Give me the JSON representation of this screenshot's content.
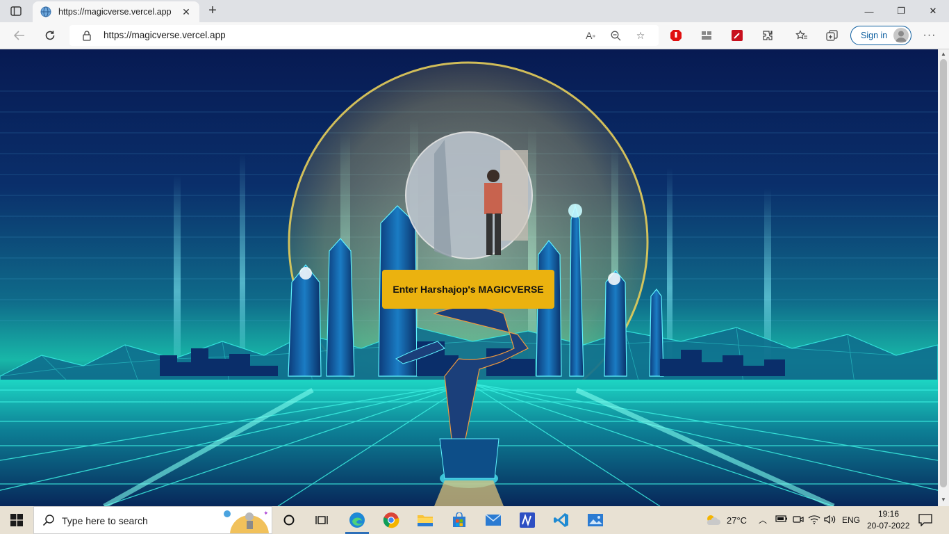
{
  "browser": {
    "tab": {
      "title": "https://magicverse.vercel.app",
      "close": "✕"
    },
    "new_tab": "+",
    "window": {
      "minimize": "—",
      "maximize": "❐",
      "close": "✕"
    },
    "url": "https://magicverse.vercel.app",
    "signin_label": "Sign in",
    "more": "···"
  },
  "page": {
    "enter_button": "Enter Harshajop's MAGICVERSE"
  },
  "taskbar": {
    "search_placeholder": "Type here to search",
    "weather": "27°C",
    "language": "ENG",
    "time": "19:16",
    "date": "20-07-2022"
  },
  "colors": {
    "accent_button": "#ebb20f",
    "signin_border": "#0a5c9e",
    "taskbar_bg": "#e8e1d3"
  }
}
